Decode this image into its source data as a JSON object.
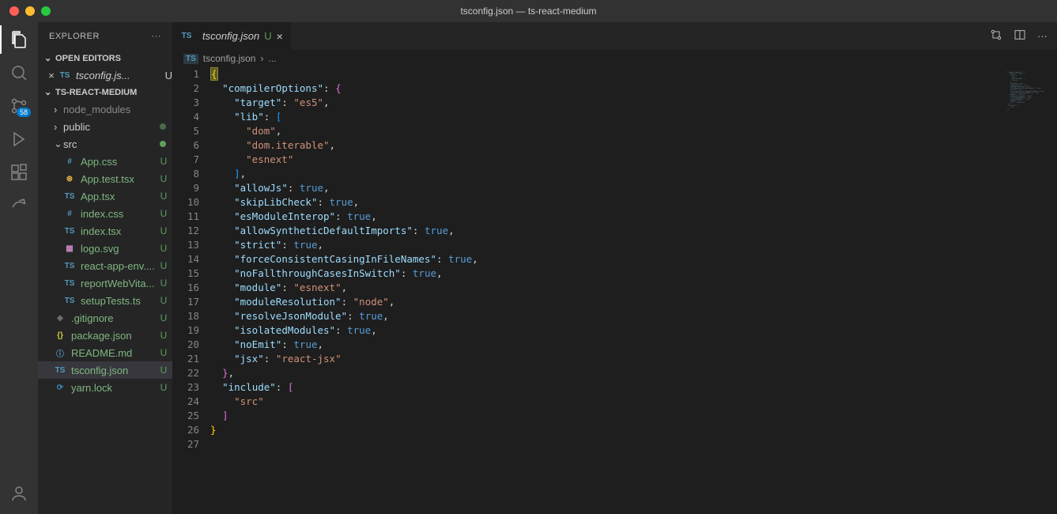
{
  "titlebar": {
    "title": "tsconfig.json — ts-react-medium"
  },
  "activity": {
    "scm_badge": "58"
  },
  "sidebar": {
    "title": "EXPLORER",
    "open_editors_label": "OPEN EDITORS",
    "open_editors": [
      {
        "name": "tsconfig.js...",
        "status": "U"
      }
    ],
    "project_label": "TS-REACT-MEDIUM",
    "tree": [
      {
        "kind": "folder",
        "name": "node_modules",
        "depth": 1,
        "expanded": false,
        "status": "",
        "icon": "chev"
      },
      {
        "kind": "folder",
        "name": "public",
        "depth": 1,
        "expanded": false,
        "status": "●",
        "icon": "chev",
        "dotdim": true
      },
      {
        "kind": "folder",
        "name": "src",
        "depth": 1,
        "expanded": true,
        "status": "●",
        "icon": "chevd"
      },
      {
        "kind": "file",
        "name": "App.css",
        "depth": 2,
        "status": "U",
        "icon": "css"
      },
      {
        "kind": "file",
        "name": "App.test.tsx",
        "depth": 2,
        "status": "U",
        "icon": "react"
      },
      {
        "kind": "file",
        "name": "App.tsx",
        "depth": 2,
        "status": "U",
        "icon": "ts"
      },
      {
        "kind": "file",
        "name": "index.css",
        "depth": 2,
        "status": "U",
        "icon": "css"
      },
      {
        "kind": "file",
        "name": "index.tsx",
        "depth": 2,
        "status": "U",
        "icon": "ts"
      },
      {
        "kind": "file",
        "name": "logo.svg",
        "depth": 2,
        "status": "U",
        "icon": "svg"
      },
      {
        "kind": "file",
        "name": "react-app-env....",
        "depth": 2,
        "status": "U",
        "icon": "ts"
      },
      {
        "kind": "file",
        "name": "reportWebVita...",
        "depth": 2,
        "status": "U",
        "icon": "ts"
      },
      {
        "kind": "file",
        "name": "setupTests.ts",
        "depth": 2,
        "status": "U",
        "icon": "ts"
      },
      {
        "kind": "file",
        "name": ".gitignore",
        "depth": 1,
        "status": "U",
        "icon": "git"
      },
      {
        "kind": "file",
        "name": "package.json",
        "depth": 1,
        "status": "U",
        "icon": "json"
      },
      {
        "kind": "file",
        "name": "README.md",
        "depth": 1,
        "status": "U",
        "icon": "info"
      },
      {
        "kind": "file",
        "name": "tsconfig.json",
        "depth": 1,
        "status": "U",
        "icon": "tsconf",
        "selected": true
      },
      {
        "kind": "file",
        "name": "yarn.lock",
        "depth": 1,
        "status": "U",
        "icon": "yarn"
      }
    ]
  },
  "tabs": {
    "items": [
      {
        "icon": "tsconf",
        "name": "tsconfig.json",
        "status": "U"
      }
    ]
  },
  "breadcrumbs": {
    "file": "tsconfig.json",
    "tail": "..."
  },
  "code": {
    "lines": 27,
    "tokens": [
      [
        [
          "{",
          "brace"
        ]
      ],
      [
        [
          "  ",
          ""
        ],
        [
          "\"compilerOptions\"",
          "key"
        ],
        [
          ": ",
          ""
        ],
        [
          "{",
          "brace2"
        ]
      ],
      [
        [
          "    ",
          ""
        ],
        [
          "\"target\"",
          "key"
        ],
        [
          ": ",
          ""
        ],
        [
          "\"es5\"",
          "str"
        ],
        [
          ",",
          ""
        ]
      ],
      [
        [
          "    ",
          ""
        ],
        [
          "\"lib\"",
          "key"
        ],
        [
          ": ",
          ""
        ],
        [
          "[",
          "brace3"
        ]
      ],
      [
        [
          "      ",
          ""
        ],
        [
          "\"dom\"",
          "str"
        ],
        [
          ",",
          ""
        ]
      ],
      [
        [
          "      ",
          ""
        ],
        [
          "\"dom.iterable\"",
          "str"
        ],
        [
          ",",
          ""
        ]
      ],
      [
        [
          "      ",
          ""
        ],
        [
          "\"esnext\"",
          "str"
        ]
      ],
      [
        [
          "    ",
          ""
        ],
        [
          "]",
          "brace3"
        ],
        [
          ",",
          ""
        ]
      ],
      [
        [
          "    ",
          ""
        ],
        [
          "\"allowJs\"",
          "key"
        ],
        [
          ": ",
          ""
        ],
        [
          "true",
          "bool"
        ],
        [
          ",",
          ""
        ]
      ],
      [
        [
          "    ",
          ""
        ],
        [
          "\"skipLibCheck\"",
          "key"
        ],
        [
          ": ",
          ""
        ],
        [
          "true",
          "bool"
        ],
        [
          ",",
          ""
        ]
      ],
      [
        [
          "    ",
          ""
        ],
        [
          "\"esModuleInterop\"",
          "key"
        ],
        [
          ": ",
          ""
        ],
        [
          "true",
          "bool"
        ],
        [
          ",",
          ""
        ]
      ],
      [
        [
          "    ",
          ""
        ],
        [
          "\"allowSyntheticDefaultImports\"",
          "key"
        ],
        [
          ": ",
          ""
        ],
        [
          "true",
          "bool"
        ],
        [
          ",",
          ""
        ]
      ],
      [
        [
          "    ",
          ""
        ],
        [
          "\"strict\"",
          "key"
        ],
        [
          ": ",
          ""
        ],
        [
          "true",
          "bool"
        ],
        [
          ",",
          ""
        ]
      ],
      [
        [
          "    ",
          ""
        ],
        [
          "\"forceConsistentCasingInFileNames\"",
          "key"
        ],
        [
          ": ",
          ""
        ],
        [
          "true",
          "bool"
        ],
        [
          ",",
          ""
        ]
      ],
      [
        [
          "    ",
          ""
        ],
        [
          "\"noFallthroughCasesInSwitch\"",
          "key"
        ],
        [
          ": ",
          ""
        ],
        [
          "true",
          "bool"
        ],
        [
          ",",
          ""
        ]
      ],
      [
        [
          "    ",
          ""
        ],
        [
          "\"module\"",
          "key"
        ],
        [
          ": ",
          ""
        ],
        [
          "\"esnext\"",
          "str"
        ],
        [
          ",",
          ""
        ]
      ],
      [
        [
          "    ",
          ""
        ],
        [
          "\"moduleResolution\"",
          "key"
        ],
        [
          ": ",
          ""
        ],
        [
          "\"node\"",
          "str"
        ],
        [
          ",",
          ""
        ]
      ],
      [
        [
          "    ",
          ""
        ],
        [
          "\"resolveJsonModule\"",
          "key"
        ],
        [
          ": ",
          ""
        ],
        [
          "true",
          "bool"
        ],
        [
          ",",
          ""
        ]
      ],
      [
        [
          "    ",
          ""
        ],
        [
          "\"isolatedModules\"",
          "key"
        ],
        [
          ": ",
          ""
        ],
        [
          "true",
          "bool"
        ],
        [
          ",",
          ""
        ]
      ],
      [
        [
          "    ",
          ""
        ],
        [
          "\"noEmit\"",
          "key"
        ],
        [
          ": ",
          ""
        ],
        [
          "true",
          "bool"
        ],
        [
          ",",
          ""
        ]
      ],
      [
        [
          "    ",
          ""
        ],
        [
          "\"jsx\"",
          "key"
        ],
        [
          ": ",
          ""
        ],
        [
          "\"react-jsx\"",
          "str"
        ]
      ],
      [
        [
          "  ",
          ""
        ],
        [
          "}",
          "brace2"
        ],
        [
          ",",
          ""
        ]
      ],
      [
        [
          "  ",
          ""
        ],
        [
          "\"include\"",
          "key"
        ],
        [
          ": ",
          ""
        ],
        [
          "[",
          "brace2"
        ]
      ],
      [
        [
          "    ",
          ""
        ],
        [
          "\"src\"",
          "str"
        ]
      ],
      [
        [
          "  ",
          ""
        ],
        [
          "]",
          "brace2"
        ]
      ],
      [
        [
          "}",
          "brace"
        ]
      ],
      [
        [
          " ",
          ""
        ]
      ]
    ]
  }
}
